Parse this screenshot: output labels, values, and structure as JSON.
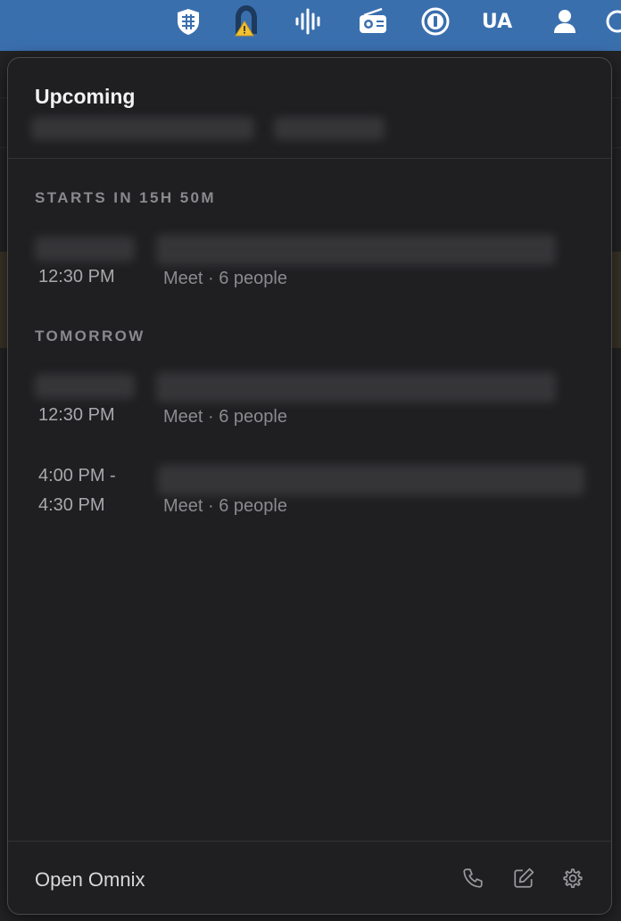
{
  "menubar": {
    "icons": [
      "vpn-shield-icon",
      "arch-warning-icon",
      "audio-waveform-icon",
      "radio-icon",
      "password-manager-icon",
      "keyboard-layout-indicator",
      "user-icon"
    ],
    "keyboard_layout": "UA",
    "background_color": "#3a6fae"
  },
  "popover": {
    "title": "Upcoming",
    "sections": [
      {
        "label": "STARTS IN 15H 50M",
        "events": [
          {
            "time": "12:30 PM",
            "meta": "Meet · 6 people"
          }
        ]
      },
      {
        "label": "TOMORROW",
        "events": [
          {
            "time": "12:30 PM",
            "meta": "Meet · 6 people"
          },
          {
            "time_start": "4:00 PM -",
            "time_end": "4:30 PM",
            "meta": "Meet · 6 people"
          }
        ]
      }
    ],
    "footer": {
      "open_label": "Open Omnix",
      "actions": [
        "phone-icon",
        "compose-icon",
        "settings-icon"
      ]
    }
  }
}
